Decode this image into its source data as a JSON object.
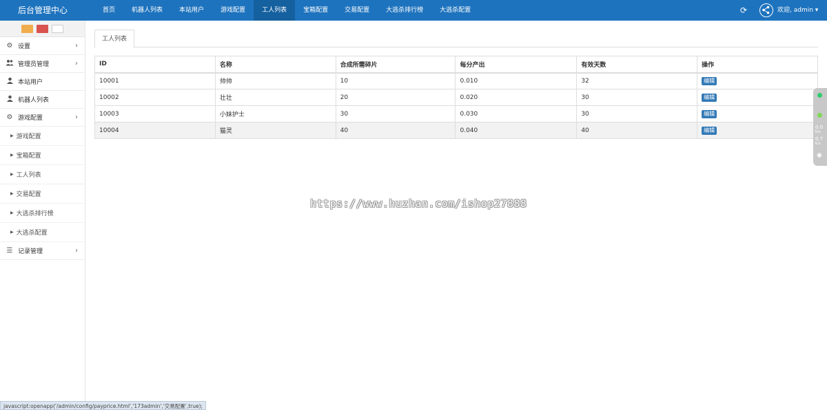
{
  "header": {
    "brand": "后台管理中心",
    "nav": [
      "首页",
      "机器人列表",
      "本站用户",
      "游戏配置",
      "工人列表",
      "宝箱配置",
      "交易配置",
      "大逃杀排行榜",
      "大逃杀配置"
    ],
    "active_nav": "工人列表",
    "welcome": "欢迎, admin ▾"
  },
  "sidebar": {
    "menu": [
      {
        "label": "设置",
        "icon": "gears-icon",
        "arrow": "›"
      },
      {
        "label": "管理员管理",
        "icon": "users-icon",
        "arrow": "›"
      },
      {
        "label": "本站用户",
        "icon": "user-icon"
      },
      {
        "label": "机器人列表",
        "icon": "user-icon"
      },
      {
        "label": "游戏配置",
        "icon": "gears-icon",
        "arrow": "›",
        "expanded": true
      }
    ],
    "submenu": [
      "游戏配置",
      "宝箱配置",
      "工人列表",
      "交易配置",
      "大逃杀排行榜",
      "大逃杀配置"
    ],
    "last": {
      "label": "记录管理",
      "icon": "list-icon",
      "arrow": "›"
    }
  },
  "tab": "工人列表",
  "table": {
    "headers": [
      "ID",
      "名称",
      "合成所需碎片",
      "每分产出",
      "有效天数",
      "操作"
    ],
    "rows": [
      [
        "10001",
        "帅帅",
        "10",
        "0.010",
        "32",
        "编辑"
      ],
      [
        "10002",
        "壮壮",
        "20",
        "0.020",
        "30",
        "编辑"
      ],
      [
        "10003",
        "小妹护士",
        "30",
        "0.030",
        "30",
        "编辑"
      ],
      [
        "10004",
        "猫灵",
        "40",
        "0.040",
        "40",
        "编辑"
      ]
    ]
  },
  "watermark": "https://www.huzhan.com/ishop27888",
  "widget": {
    "v1": "0.0",
    "v1_unit": "K/s",
    "v2": "0.7",
    "v2_unit": "K/s"
  },
  "status_url": "javascript:openapp('/admin/config/payprice.html','173admin','交易配置',true);",
  "colors": {
    "topbar": "#1e73be",
    "active_nav": "#15609f",
    "edit_button": "#337ab7"
  }
}
